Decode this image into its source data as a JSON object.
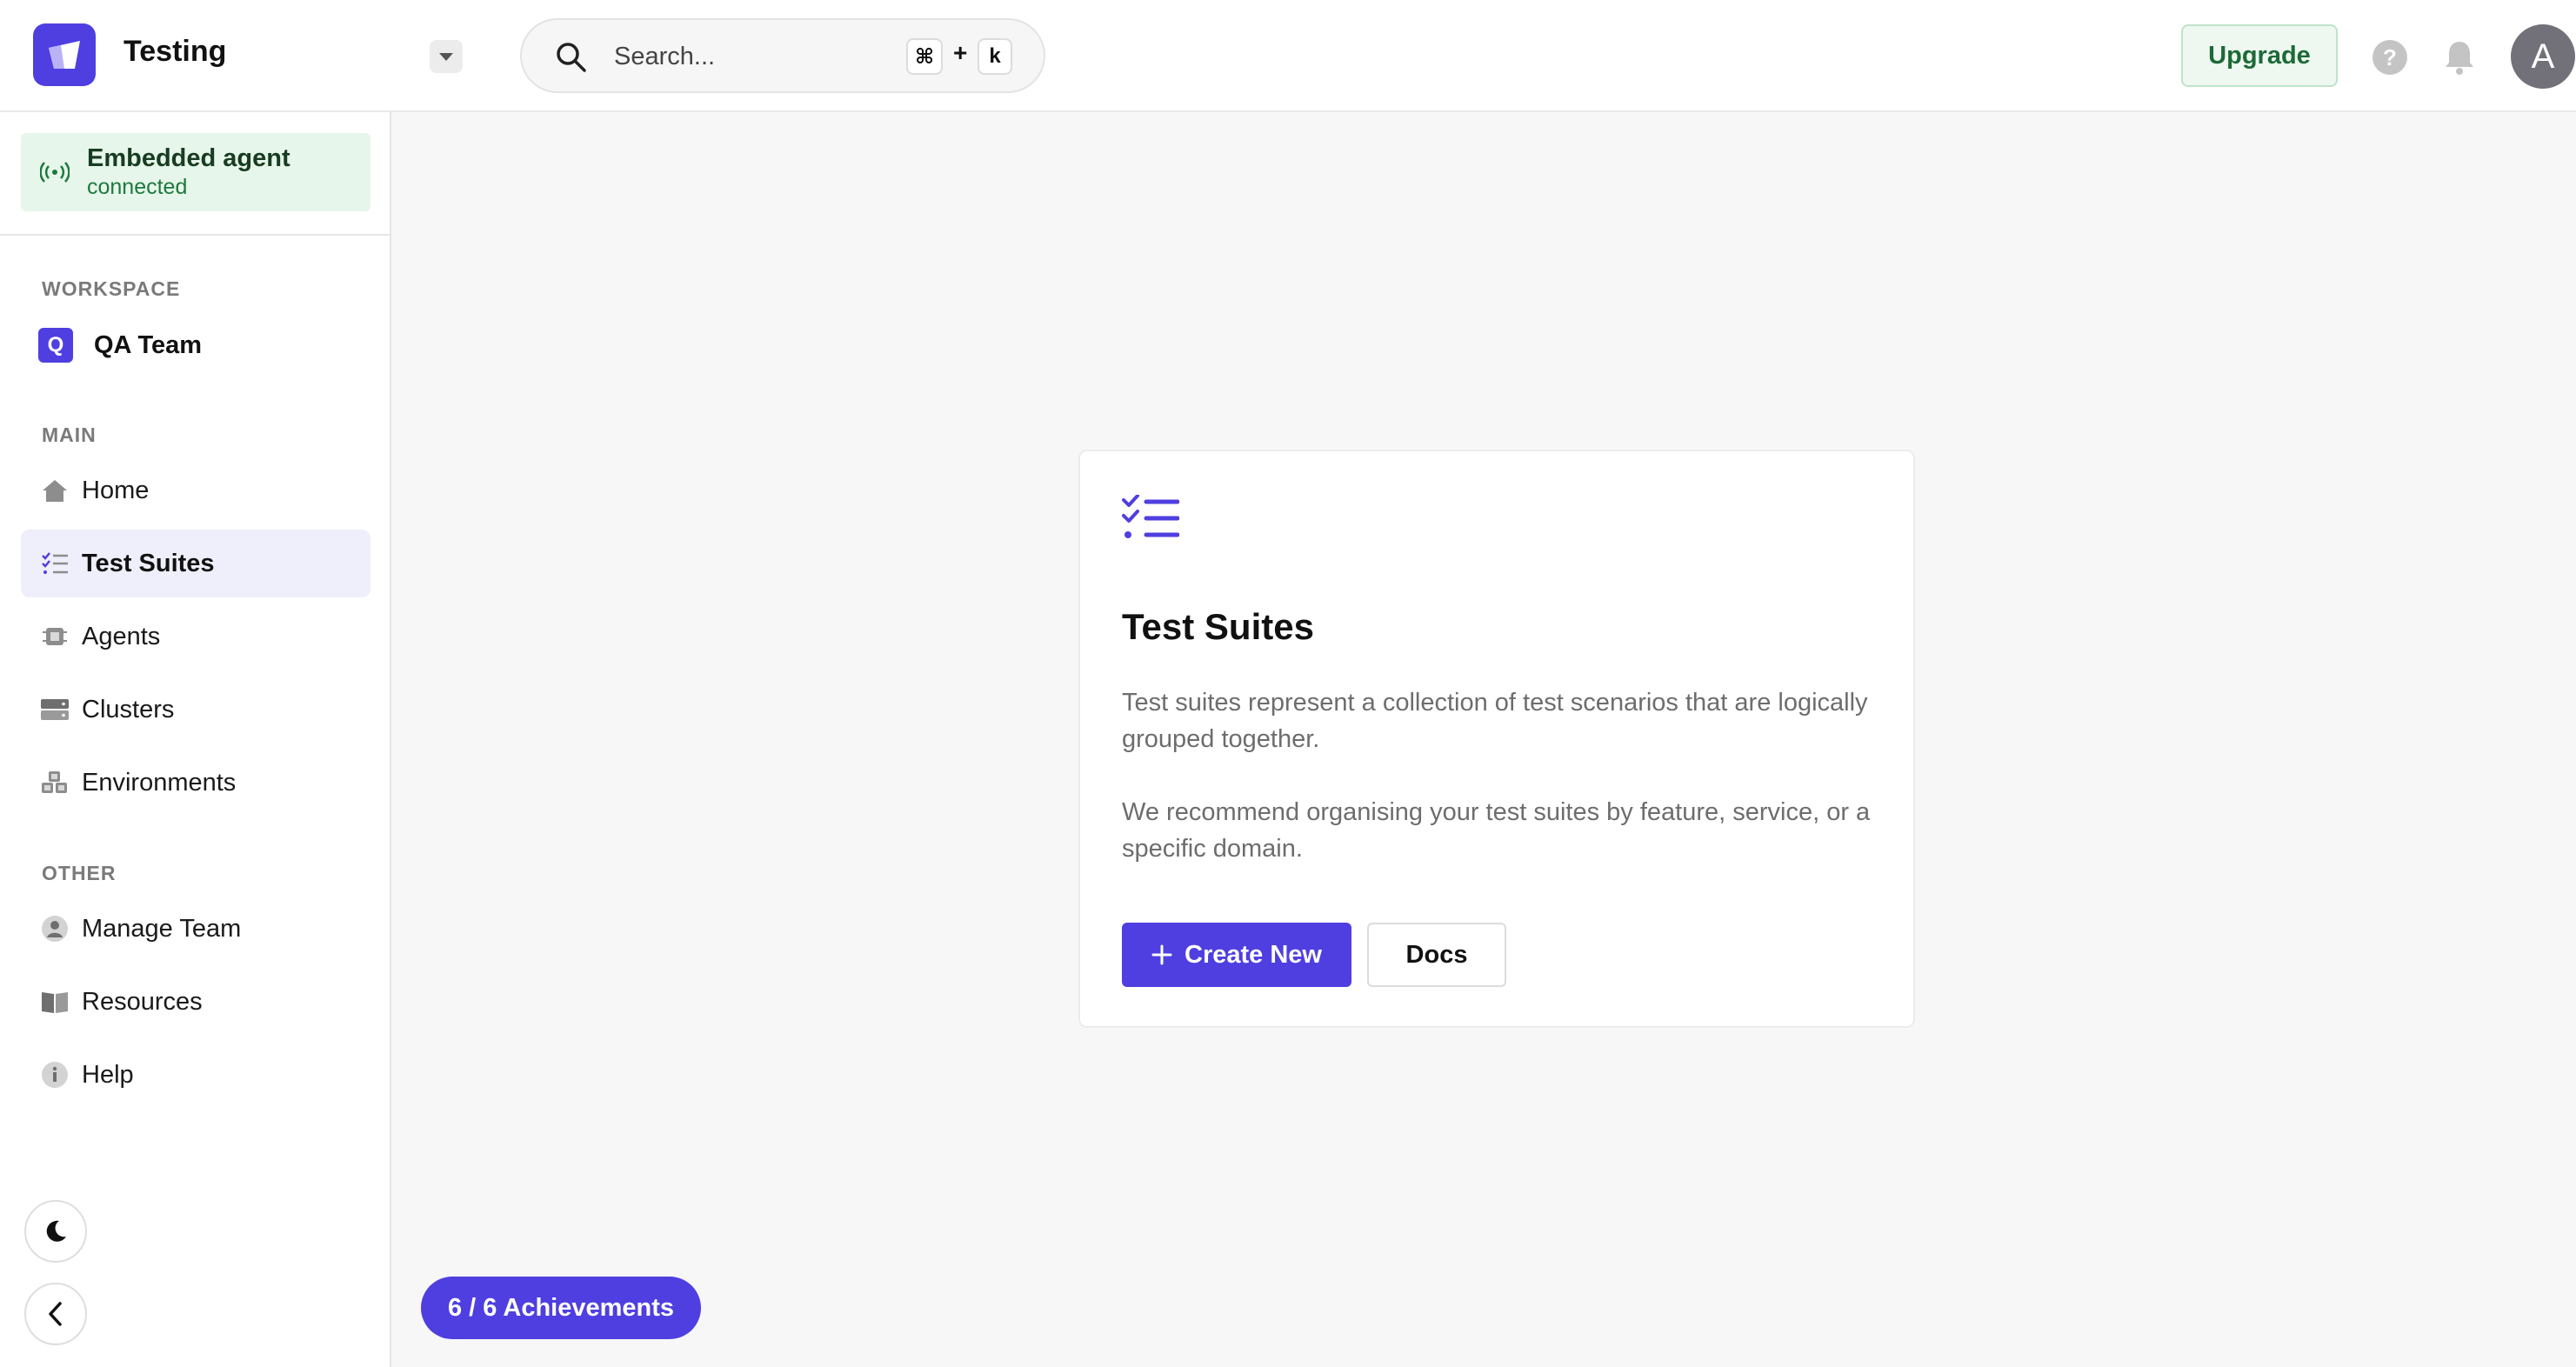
{
  "app": {
    "title": "Testing"
  },
  "search": {
    "placeholder": "Search...",
    "shortcut_keys": [
      "⌘",
      "k"
    ],
    "shortcut_joiner": "+"
  },
  "header": {
    "upgrade_label": "Upgrade",
    "help_glyph": "?",
    "avatar_initial": "A"
  },
  "agent": {
    "title": "Embedded agent",
    "status": "connected"
  },
  "sidebar": {
    "workspace_label": "WORKSPACE",
    "workspace": {
      "initial": "Q",
      "name": "QA Team"
    },
    "main_label": "MAIN",
    "main_items": [
      {
        "label": "Home",
        "icon": "home-icon"
      },
      {
        "label": "Test Suites",
        "icon": "checklist-icon",
        "active": true
      },
      {
        "label": "Agents",
        "icon": "chip-icon"
      },
      {
        "label": "Clusters",
        "icon": "server-icon"
      },
      {
        "label": "Environments",
        "icon": "cubes-icon"
      }
    ],
    "other_label": "OTHER",
    "other_items": [
      {
        "label": "Manage Team",
        "icon": "user-icon"
      },
      {
        "label": "Resources",
        "icon": "book-icon"
      },
      {
        "label": "Help",
        "icon": "info-icon"
      }
    ]
  },
  "card": {
    "title": "Test Suites",
    "paragraph1": "Test suites represent a collection of test scenarios that are logically grouped together.",
    "paragraph2": "We recommend organising your test suites by feature, service, or a specific domain.",
    "create_label": "Create New",
    "docs_label": "Docs"
  },
  "achievements": {
    "label": "6 / 6 Achievements"
  },
  "colors": {
    "accent": "#4f3fe0",
    "success_bg": "#e7f6ea",
    "success_text": "#1c7a3e"
  }
}
